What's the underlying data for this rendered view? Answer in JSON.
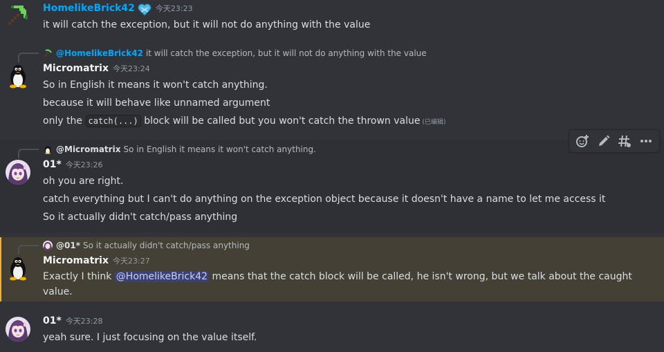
{
  "colors": {
    "background": "#313338",
    "mention_highlight": "#444035",
    "username_blue": "#00a8fc"
  },
  "messages": [
    {
      "author": "HomelikeBrick42",
      "avatar_icon": "pickaxe-icon",
      "badge_icon": "heart-badge-icon",
      "time": "今天23:23",
      "lines": [
        "it will catch the exception, but it will not do anything with the value"
      ]
    },
    {
      "reply": {
        "name": "@HomelikeBrick42",
        "text": "it will catch the exception, but it will not do anything with the value"
      },
      "author": "Micromatrix",
      "avatar_icon": "tux-penguin-icon",
      "time": "今天23:24",
      "lines": [
        "So in English it means it won't catch anything.",
        "because it will behave like unnamed argument"
      ],
      "line3": {
        "before": "only the",
        "code": "catch(...)",
        "after": "block will be called but you won't catch the thrown value",
        "edited": "(已编辑)"
      }
    },
    {
      "reply": {
        "name": "@Micromatrix",
        "text": "So in English it means it won't catch anything."
      },
      "author": "01*",
      "avatar_icon": "anime-avatar-icon",
      "time": "今天23:26",
      "lines": [
        "oh you are right.",
        "catch everything but I can't do anything on the exception object because it doesn't have a name to let me access it",
        "So it actually didn't catch/pass anything"
      ]
    },
    {
      "reply": {
        "name": "@01*",
        "text": "So it actually didn't catch/pass anything"
      },
      "author": "Micromatrix",
      "avatar_icon": "tux-penguin-icon",
      "time": "今天23:27",
      "body": {
        "before": "Exactly I think",
        "mention": "@HomelikeBrick42",
        "after": "means that the catch block will be called, he isn't wrong, but we talk about the caught value."
      }
    },
    {
      "author": "01*",
      "avatar_icon": "anime-avatar-icon",
      "time": "今天23:28",
      "lines": [
        "yeah sure. I just focusing on the value itself."
      ]
    }
  ],
  "toolbar": {
    "buttons": [
      "add-reaction-icon",
      "edit-pencil-icon",
      "create-thread-icon",
      "more-options-icon"
    ]
  }
}
